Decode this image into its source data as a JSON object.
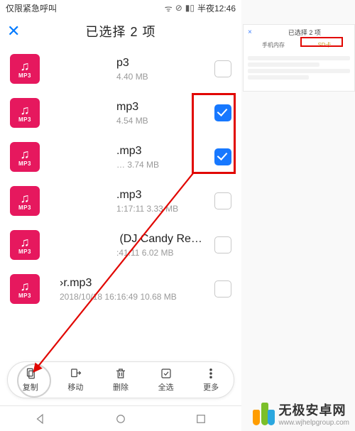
{
  "statusbar": {
    "left": "仅限紧急呼叫",
    "time": "半夜12:46"
  },
  "header": {
    "close_glyph": "✕",
    "title": "已选择 2 项"
  },
  "files": [
    {
      "name": "p3",
      "meta": "4.40 MB",
      "checked": false
    },
    {
      "name": "mp3",
      "meta": "4.54 MB",
      "checked": true
    },
    {
      "name": "‌.mp3",
      "meta": "… 3.74 MB",
      "checked": true
    },
    {
      "name": "‌.mp3",
      "meta": "1:17:11 3.33 MB",
      "checked": false
    },
    {
      "name": "‌ (DJ Candy Remix).m…",
      "meta": ":41:11 6.02 MB",
      "checked": false
    },
    {
      "name": "›r.mp3",
      "meta": "2018/10/18 16:16:49 10.68 MB",
      "checked": false
    }
  ],
  "mp3_label": "MP3",
  "mp3_note": "♫",
  "actions": {
    "copy": "复制",
    "move": "移动",
    "delete": "删除",
    "select_all": "全选",
    "more": "更多"
  },
  "thumb": {
    "title": "已选择 2 项",
    "tab_phone": "手机内存",
    "tab_sd": "SD卡"
  },
  "watermark": {
    "cn": "无极安卓网",
    "en": "www.wjhelpgroup.com"
  }
}
